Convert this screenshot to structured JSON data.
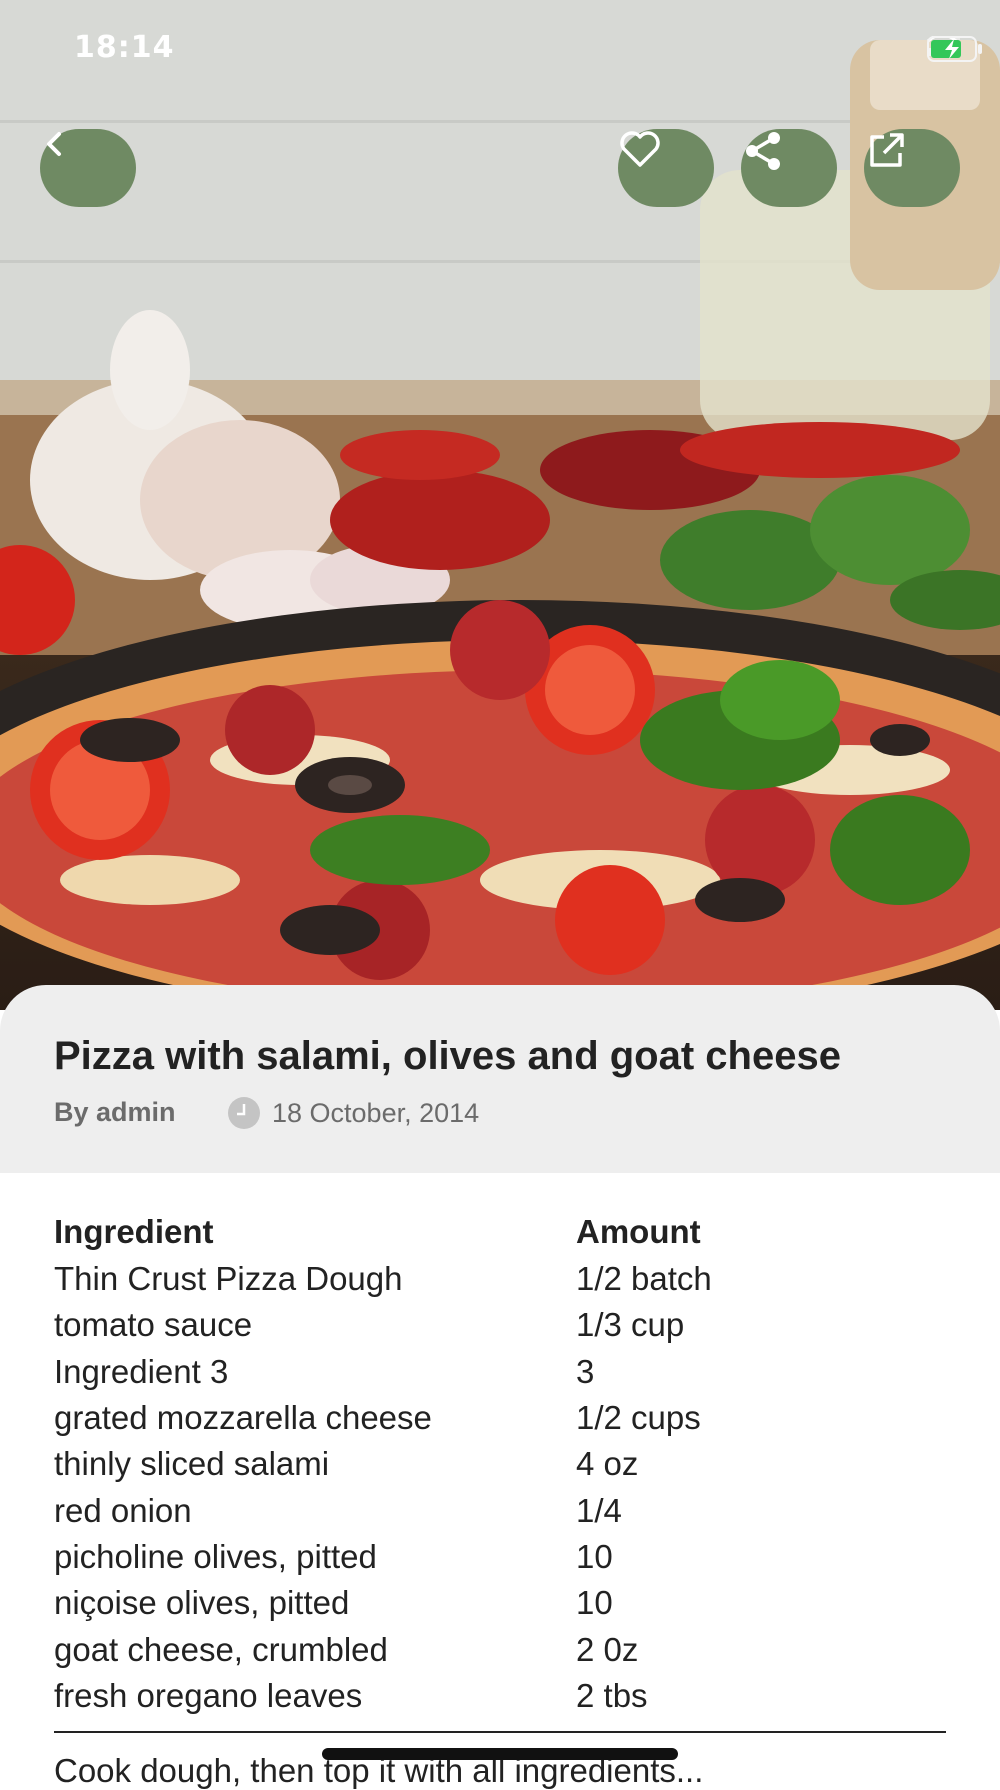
{
  "status_bar": {
    "time": "18:14"
  },
  "hero": {
    "image_description_icon": "pizza-photo"
  },
  "actions": {
    "back_icon": "chevron-left-icon",
    "favorite_icon": "heart-icon",
    "share_icon": "share-icon",
    "open_external_icon": "external-link-icon",
    "button_color": "#6f8a63"
  },
  "recipe": {
    "title": "Pizza with salami, olives and goat cheese",
    "author": "By admin",
    "date": "18 October, 2014"
  },
  "ingredients": {
    "headers": {
      "ingredient": "Ingredient",
      "amount": "Amount"
    },
    "rows": [
      {
        "ingredient": "Thin Crust Pizza Dough",
        "amount": "1/2 batch"
      },
      {
        "ingredient": "tomato sauce",
        "amount": "1/3 cup"
      },
      {
        "ingredient": "Ingredient 3",
        "amount": "3"
      },
      {
        "ingredient": "grated mozzarella cheese",
        "amount": "1/2 cups"
      },
      {
        "ingredient": "thinly sliced salami",
        "amount": "4 oz"
      },
      {
        "ingredient": "red onion",
        "amount": "1/4"
      },
      {
        "ingredient": "picholine olives, pitted",
        "amount": "10"
      },
      {
        "ingredient": "niçoise olives, pitted",
        "amount": "10"
      },
      {
        "ingredient": "goat cheese, crumbled",
        "amount": "2 0z"
      },
      {
        "ingredient": "fresh oregano leaves",
        "amount": "2 tbs"
      }
    ]
  },
  "next_text_partial": "Cook dough, then top it with all ingredients..."
}
